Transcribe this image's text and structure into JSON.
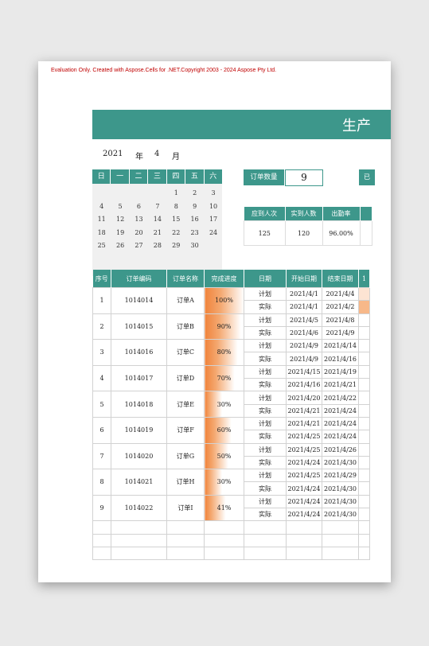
{
  "watermark": "Evaluation Only. Created with Aspose.Cells for .NET.Copyright 2003 - 2024 Aspose Pty Ltd.",
  "title": "生产",
  "year": "2021",
  "year_label": "年",
  "month": "4",
  "month_label": "月",
  "weekdays": [
    "日",
    "一",
    "二",
    "三",
    "四",
    "五",
    "六"
  ],
  "calendar_days": [
    "",
    "",
    "",
    "",
    "1",
    "2",
    "3",
    "4",
    "5",
    "6",
    "7",
    "8",
    "9",
    "10",
    "11",
    "12",
    "13",
    "14",
    "15",
    "16",
    "17",
    "18",
    "19",
    "20",
    "21",
    "22",
    "23",
    "24",
    "25",
    "26",
    "27",
    "28",
    "29",
    "30",
    ""
  ],
  "order_count_label": "订单数量",
  "order_count": "9",
  "cut_label": "已",
  "attendance": {
    "headers": [
      "应到人次",
      "实到人数",
      "出勤率"
    ],
    "values": [
      "125",
      "120",
      "96.00%"
    ]
  },
  "table": {
    "headers": [
      "序号",
      "订单编码",
      "订单名称",
      "完成进度",
      "日期",
      "开始日期",
      "结束日期",
      "1"
    ],
    "plan_label": "计划",
    "actual_label": "实际",
    "orders": [
      {
        "no": "1",
        "code": "1014014",
        "name": "订单A",
        "progress": "100%",
        "plan": [
          "2021/4/1",
          "2021/4/4"
        ],
        "actual": [
          "2021/4/1",
          "2021/4/2"
        ]
      },
      {
        "no": "2",
        "code": "1014015",
        "name": "订单B",
        "progress": "90%",
        "plan": [
          "2021/4/5",
          "2021/4/8"
        ],
        "actual": [
          "2021/4/6",
          "2021/4/9"
        ]
      },
      {
        "no": "3",
        "code": "1014016",
        "name": "订单C",
        "progress": "80%",
        "plan": [
          "2021/4/9",
          "2021/4/14"
        ],
        "actual": [
          "2021/4/9",
          "2021/4/16"
        ]
      },
      {
        "no": "4",
        "code": "1014017",
        "name": "订单D",
        "progress": "70%",
        "plan": [
          "2021/4/15",
          "2021/4/19"
        ],
        "actual": [
          "2021/4/16",
          "2021/4/21"
        ]
      },
      {
        "no": "5",
        "code": "1014018",
        "name": "订单E",
        "progress": "30%",
        "plan": [
          "2021/4/20",
          "2021/4/22"
        ],
        "actual": [
          "2021/4/21",
          "2021/4/24"
        ]
      },
      {
        "no": "6",
        "code": "1014019",
        "name": "订单F",
        "progress": "60%",
        "plan": [
          "2021/4/21",
          "2021/4/24"
        ],
        "actual": [
          "2021/4/25",
          "2021/4/24"
        ]
      },
      {
        "no": "7",
        "code": "1014020",
        "name": "订单G",
        "progress": "50%",
        "plan": [
          "2021/4/25",
          "2021/4/26"
        ],
        "actual": [
          "2021/4/24",
          "2021/4/30"
        ]
      },
      {
        "no": "8",
        "code": "1014021",
        "name": "订单H",
        "progress": "30%",
        "plan": [
          "2021/4/25",
          "2021/4/29"
        ],
        "actual": [
          "2021/4/24",
          "2021/4/30"
        ]
      },
      {
        "no": "9",
        "code": "1014022",
        "name": "订单I",
        "progress": "41%",
        "plan": [
          "2021/4/24",
          "2021/4/30"
        ],
        "actual": [
          "2021/4/24",
          "2021/4/30"
        ]
      }
    ]
  },
  "colors": {
    "teal": "#3d978b",
    "orange": "#f0843c",
    "watermark": "#c00000"
  }
}
